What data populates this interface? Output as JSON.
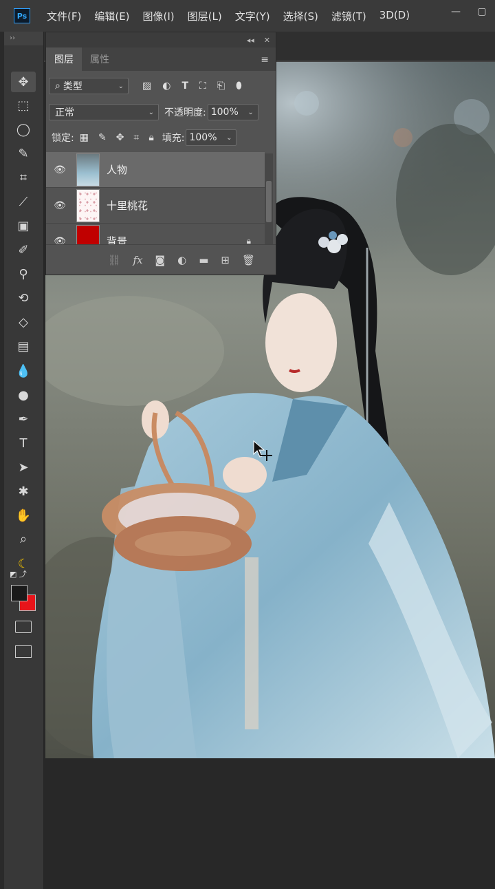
{
  "app": {
    "logo": "Ps"
  },
  "menu": [
    "文件(F)",
    "编辑(E)",
    "图像(I)",
    "图层(L)",
    "文字(Y)",
    "选择(S)",
    "滤镜(T)",
    "3D(D)"
  ],
  "window_controls": {
    "minimize": "—",
    "restore": "▢"
  },
  "toolbar": {
    "collapse": "››",
    "tools": [
      {
        "name": "move-tool",
        "icon": "✥"
      },
      {
        "name": "marquee-tool",
        "icon": "⬚"
      },
      {
        "name": "lasso-tool",
        "icon": "◯"
      },
      {
        "name": "quick-select-tool",
        "icon": "✎"
      },
      {
        "name": "crop-tool",
        "icon": "⌗"
      },
      {
        "name": "eyedropper-tool",
        "icon": "⟋"
      },
      {
        "name": "frame-tool",
        "icon": "▣"
      },
      {
        "name": "brush-tool",
        "icon": "✐"
      },
      {
        "name": "stamp-tool",
        "icon": "⚲"
      },
      {
        "name": "history-brush-tool",
        "icon": "⟲"
      },
      {
        "name": "eraser-tool",
        "icon": "◇"
      },
      {
        "name": "gradient-tool",
        "icon": "▤"
      },
      {
        "name": "blur-tool",
        "icon": "💧"
      },
      {
        "name": "dodge-tool",
        "icon": "●"
      },
      {
        "name": "pen-tool",
        "icon": "✒"
      },
      {
        "name": "type-tool",
        "icon": "T"
      },
      {
        "name": "path-select-tool",
        "icon": "➤"
      },
      {
        "name": "shape-tool",
        "icon": "✱"
      },
      {
        "name": "hand-tool",
        "icon": "✋"
      },
      {
        "name": "zoom-tool",
        "icon": "⌕"
      },
      {
        "name": "banana-icon",
        "icon": "☾"
      }
    ],
    "colors": {
      "foreground": "#1a1a1a",
      "background": "#e8141a"
    }
  },
  "layers_panel": {
    "top_controls": {
      "collapse": "◂◂",
      "close": "✕"
    },
    "tabs": [
      "图层",
      "属性"
    ],
    "menu_icon": "≡",
    "filter": {
      "label": "类型",
      "icon": "⌕"
    },
    "filter_icons": [
      "image-filter-icon",
      "adjustment-filter-icon",
      "type-filter-icon",
      "shape-filter-icon",
      "smart-object-filter-icon",
      "toggle-filter-icon"
    ],
    "blend_mode": "正常",
    "opacity_label": "不透明度:",
    "opacity_value": "100%",
    "lock_label": "锁定:",
    "fill_label": "填充:",
    "fill_value": "100%",
    "layers": [
      {
        "name": "人物",
        "selected": true,
        "thumb": "person"
      },
      {
        "name": "十里桃花",
        "selected": false,
        "thumb": "petals"
      },
      {
        "name": "背景",
        "selected": false,
        "thumb": "red",
        "locked": true
      }
    ],
    "footer_icons": [
      "link-icon",
      "fx-icon",
      "mask-icon",
      "adjustment-icon",
      "folder-icon",
      "new-layer-icon",
      "trash-icon"
    ]
  }
}
